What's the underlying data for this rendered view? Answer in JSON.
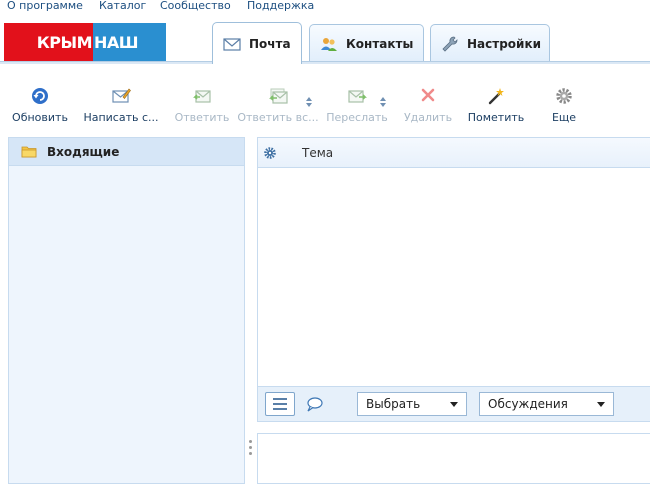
{
  "top_nav": [
    "О программе",
    "Каталог",
    "Сообщество",
    "Поддержка"
  ],
  "logo": {
    "part1": "КРЫМ",
    "part2": "НАШ"
  },
  "tabs": [
    {
      "label": "Почта",
      "icon": "envelope-icon",
      "active": true
    },
    {
      "label": "Контакты",
      "icon": "contacts-icon",
      "active": false
    },
    {
      "label": "Настройки",
      "icon": "wrench-icon",
      "active": false
    }
  ],
  "toolbar": [
    {
      "label": "Обновить",
      "icon": "refresh-icon",
      "enabled": true
    },
    {
      "label": "Написать с...",
      "icon": "compose-icon",
      "enabled": true
    },
    {
      "label": "Ответить",
      "icon": "reply-icon",
      "enabled": false
    },
    {
      "label": "Ответить вс...",
      "icon": "reply-all-icon",
      "enabled": false
    },
    {
      "label": "Переслать",
      "icon": "forward-icon",
      "enabled": false
    },
    {
      "label": "Удалить",
      "icon": "delete-icon",
      "enabled": false
    },
    {
      "label": "Пометить",
      "icon": "magic-wand-icon",
      "enabled": true
    },
    {
      "label": "Еще",
      "icon": "gear-icon",
      "enabled": true
    }
  ],
  "sidebar": {
    "folders": [
      {
        "label": "Входящие",
        "icon": "folder-icon",
        "selected": true
      }
    ]
  },
  "message_list": {
    "columns": [
      "Тема"
    ]
  },
  "footer": {
    "select_label": "Выбрать",
    "threads_label": "Обсуждения"
  },
  "colors": {
    "accent": "#2a8fd0",
    "logo_red": "#e2111b",
    "panel_bg": "#eef5fd",
    "selected_bg": "#d6e6f7",
    "border": "#c7dbef"
  }
}
